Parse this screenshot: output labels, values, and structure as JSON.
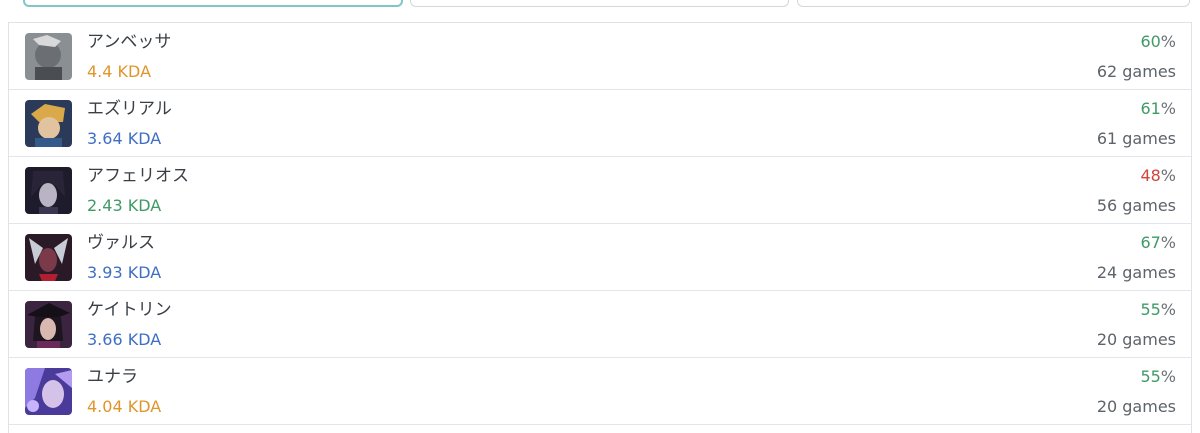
{
  "tabs": [
    {
      "label": "",
      "active": true
    },
    {
      "label": "",
      "active": false
    },
    {
      "label": "",
      "active": false
    }
  ],
  "champions": [
    {
      "name": "アンベッサ",
      "kda": "4.4 KDA",
      "kda_color": "#e0952a",
      "winrate": "60",
      "winrate_color": "#3f9a66",
      "pct": "%",
      "games": "62 games",
      "icon": "ambessa-portrait-icon",
      "tone": "#6b6f74"
    },
    {
      "name": "エズリアル",
      "kda": "3.64 KDA",
      "kda_color": "#3f6fc4",
      "winrate": "61",
      "winrate_color": "#3f9a66",
      "pct": "%",
      "games": "61 games",
      "icon": "ezreal-portrait-icon",
      "tone": "#a8773a"
    },
    {
      "name": "アフェリオス",
      "kda": "2.43 KDA",
      "kda_color": "#3f9a66",
      "winrate": "48",
      "winrate_color": "#d0453c",
      "pct": "%",
      "games": "56 games",
      "icon": "aphelios-portrait-icon",
      "tone": "#3a3550"
    },
    {
      "name": "ヴァルス",
      "kda": "3.93 KDA",
      "kda_color": "#3f6fc4",
      "winrate": "67",
      "winrate_color": "#3f9a66",
      "pct": "%",
      "games": "24 games",
      "icon": "varus-portrait-icon",
      "tone": "#5a2030"
    },
    {
      "name": "ケイトリン",
      "kda": "3.66 KDA",
      "kda_color": "#3f6fc4",
      "winrate": "55",
      "winrate_color": "#3f9a66",
      "pct": "%",
      "games": "20 games",
      "icon": "caitlyn-portrait-icon",
      "tone": "#3b2440"
    },
    {
      "name": "ユナラ",
      "kda": "4.04 KDA",
      "kda_color": "#e0952a",
      "winrate": "55",
      "winrate_color": "#3f9a66",
      "pct": "%",
      "games": "20 games",
      "icon": "yunara-portrait-icon",
      "tone": "#6a4fb0"
    }
  ]
}
